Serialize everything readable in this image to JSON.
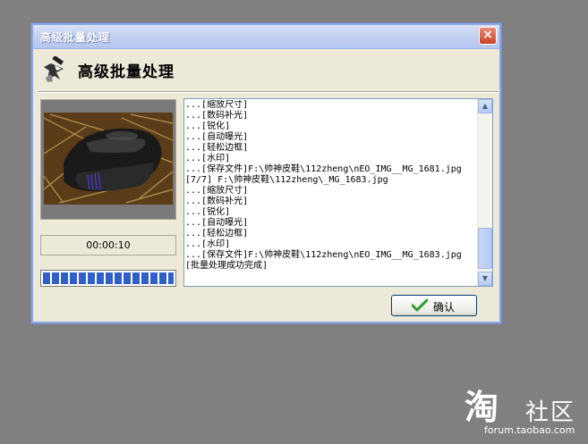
{
  "window": {
    "title": "高级批量处理",
    "close_symbol": "×"
  },
  "header": {
    "title": "高级批量处理",
    "icon": "batch-process-icon"
  },
  "preview": {
    "image": "shoe-photo"
  },
  "timer": {
    "value": "00:00:10"
  },
  "progress": {
    "fraction": 1.0
  },
  "log": {
    "lines": [
      "...[缩放尺寸]",
      "...[数码补光]",
      "...[锐化]",
      "...[自动曝光]",
      "...[轻松边框]",
      "...[水印]",
      "...[保存文件]F:\\帅神皮鞋\\112zheng\\nEO_IMG__MG_1681.jpg",
      "[7/7] F:\\帅神皮鞋\\112zheng\\_MG_1683.jpg",
      "...[缩放尺寸]",
      "...[数码补光]",
      "...[锐化]",
      "...[自动曝光]",
      "...[轻松边框]",
      "...[水印]",
      "...[保存文件]F:\\帅神皮鞋\\112zheng\\nEO_IMG__MG_1683.jpg",
      "[批量处理成功完成]"
    ]
  },
  "buttons": {
    "ok_label": "确认",
    "ok_icon": "checkmark-icon"
  },
  "watermark": {
    "logo_char": "淘",
    "text": "社区",
    "url": "forum.taobao.com"
  }
}
